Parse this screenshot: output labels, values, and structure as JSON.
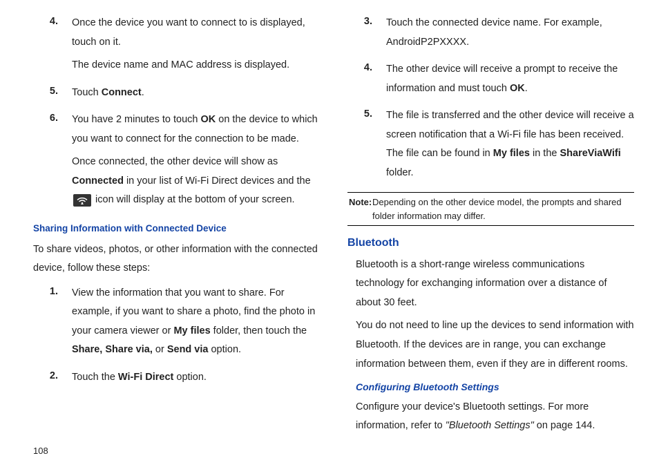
{
  "left": {
    "items": [
      {
        "n": "4.",
        "paras": [
          [
            {
              "t": "Once the device you want to connect to is displayed, touch on it."
            }
          ],
          [
            {
              "t": "The device name and MAC address is displayed."
            }
          ]
        ]
      },
      {
        "n": "5.",
        "paras": [
          [
            {
              "t": "Touch "
            },
            {
              "t": "Connect",
              "b": true
            },
            {
              "t": "."
            }
          ]
        ]
      },
      {
        "n": "6.",
        "paras": [
          [
            {
              "t": "You have 2 minutes to touch "
            },
            {
              "t": "OK",
              "b": true
            },
            {
              "t": " on the device to which you want to connect for the connection to be made."
            }
          ],
          [
            {
              "t": "Once connected, the other device will show as "
            },
            {
              "t": "Connected",
              "b": true
            },
            {
              "t": " in your list of Wi-Fi Direct devices and the "
            },
            {
              "icon": true
            },
            {
              "t": " icon will display at the bottom of your screen."
            }
          ]
        ]
      }
    ],
    "h_share": "Sharing Information with Connected Device",
    "share_intro": "To share videos, photos, or other information with the connected device, follow these steps:",
    "share_items": [
      {
        "n": "1.",
        "paras": [
          [
            {
              "t": "View the information that you want to share. For example, if you want to share a photo, find the photo in your camera viewer or "
            },
            {
              "t": "My files",
              "b": true
            },
            {
              "t": " folder, then touch the "
            },
            {
              "t": "Share, Share via,",
              "b": true
            },
            {
              "t": " or "
            },
            {
              "t": "Send via",
              "b": true
            },
            {
              "t": " option."
            }
          ]
        ]
      },
      {
        "n": "2.",
        "paras": [
          [
            {
              "t": "Touch the "
            },
            {
              "t": "Wi-Fi Direct",
              "b": true
            },
            {
              "t": " option."
            }
          ]
        ]
      }
    ]
  },
  "right": {
    "items": [
      {
        "n": "3.",
        "paras": [
          [
            {
              "t": "Touch the connected device name. For example, AndroidP2PXXXX."
            }
          ]
        ]
      },
      {
        "n": "4.",
        "paras": [
          [
            {
              "t": "The other device will receive a prompt to receive the information and must touch "
            },
            {
              "t": "OK",
              "b": true
            },
            {
              "t": "."
            }
          ]
        ]
      },
      {
        "n": "5.",
        "paras": [
          [
            {
              "t": "The file is transferred and the other device will receive a screen notification that a Wi-Fi file has been received. The file can be found in "
            },
            {
              "t": "My files",
              "b": true
            },
            {
              "t": " in the "
            },
            {
              "t": "ShareViaWifi",
              "b": true
            },
            {
              "t": " folder."
            }
          ]
        ]
      }
    ],
    "note_label": "Note:",
    "note_body": " Depending on the other device model, the prompts and shared folder information may differ.",
    "h_bt": "Bluetooth",
    "bt_p1": "Bluetooth is a short-range wireless communications technology for exchanging information over a distance of about 30 feet.",
    "bt_p2": "You do not need to line up the devices to send information with Bluetooth. If the devices are in range, you can exchange information between them, even if they are in different rooms.",
    "h_cfg": "Configuring Bluetooth Settings",
    "cfg_pre": "Configure your device's Bluetooth settings. For more information, refer to ",
    "cfg_ref": "\"Bluetooth Settings\" ",
    "cfg_post": " on page 144."
  },
  "pagenum": "108"
}
